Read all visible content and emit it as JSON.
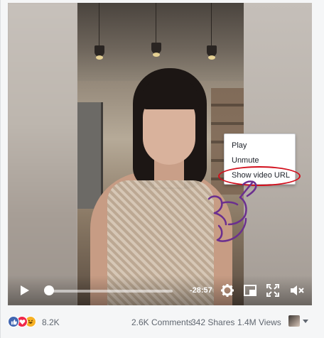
{
  "context_menu": {
    "items": [
      "Play",
      "Unmute",
      "Show video URL"
    ],
    "highlight_color": "#d20f1c"
  },
  "controls": {
    "time_remaining": "-28:57",
    "progress": 0.02
  },
  "stats": {
    "reactions_count": "8.2K",
    "comments": "2.6K Comments",
    "shares": "342 Shares",
    "views": "1.4M Views"
  },
  "colors": {
    "like": "#4267b2",
    "love": "#f0284a",
    "haha": "#f7b125",
    "annotation_hand": "#6b2f8f"
  },
  "icons": [
    "play-icon",
    "settings-gear-icon",
    "picture-in-picture-icon",
    "fullscreen-icon",
    "muted-speaker-icon",
    "like-reaction-icon",
    "love-reaction-icon",
    "haha-reaction-icon",
    "caret-down-icon"
  ]
}
